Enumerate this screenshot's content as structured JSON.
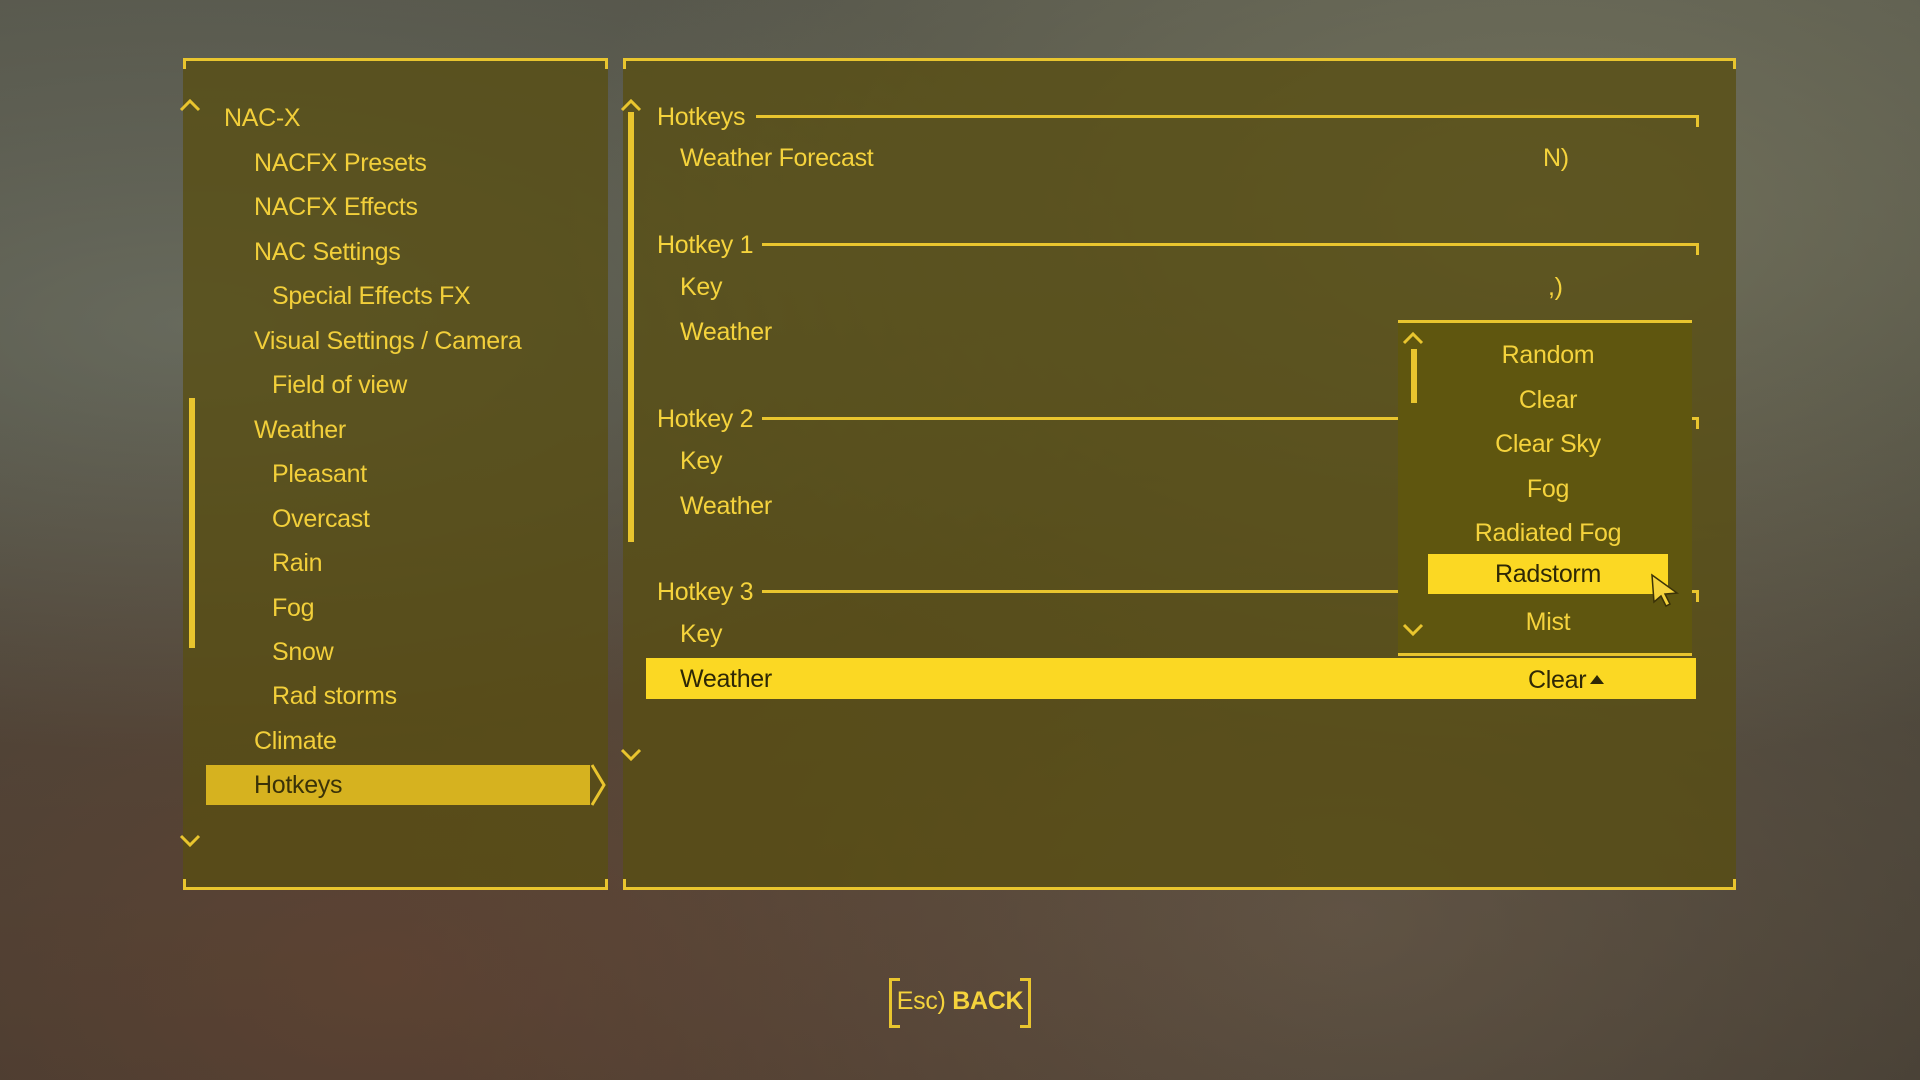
{
  "nav": {
    "items": [
      {
        "label": "NAC-X"
      },
      {
        "label": "NACFX Presets"
      },
      {
        "label": "NACFX Effects"
      },
      {
        "label": "NAC Settings"
      },
      {
        "label": "Special Effects FX"
      },
      {
        "label": "Visual Settings / Camera"
      },
      {
        "label": "Field of view"
      },
      {
        "label": "Weather"
      },
      {
        "label": "Pleasant"
      },
      {
        "label": "Overcast"
      },
      {
        "label": "Rain"
      },
      {
        "label": "Fog"
      },
      {
        "label": "Snow"
      },
      {
        "label": "Rad storms"
      },
      {
        "label": "Climate"
      },
      {
        "label": "Hotkeys"
      }
    ],
    "selected_index": 15
  },
  "content": {
    "hotkeys_header": "Hotkeys",
    "weather_forecast_label": "Weather Forecast",
    "weather_forecast_value": "N)",
    "hotkey1": {
      "title": "Hotkey 1",
      "key_label": "Key",
      "key_value": ",)",
      "weather_label": "Weather"
    },
    "hotkey2": {
      "title": "Hotkey 2",
      "key_label": "Key",
      "weather_label": "Weather"
    },
    "hotkey3": {
      "title": "Hotkey 3",
      "key_label": "Key",
      "weather_label": "Weather",
      "weather_value": "Clear"
    }
  },
  "dropdown": {
    "options": [
      "Random",
      "Clear",
      "Clear Sky",
      "Fog",
      "Radiated Fog",
      "Radstorm",
      "Mist"
    ],
    "highlighted": "Radstorm"
  },
  "footer": {
    "back_key": "Esc)",
    "back_label": "BACK"
  },
  "colors": {
    "accent": "#f5d33c",
    "highlight": "#fbd823",
    "panel": "#584e12"
  }
}
